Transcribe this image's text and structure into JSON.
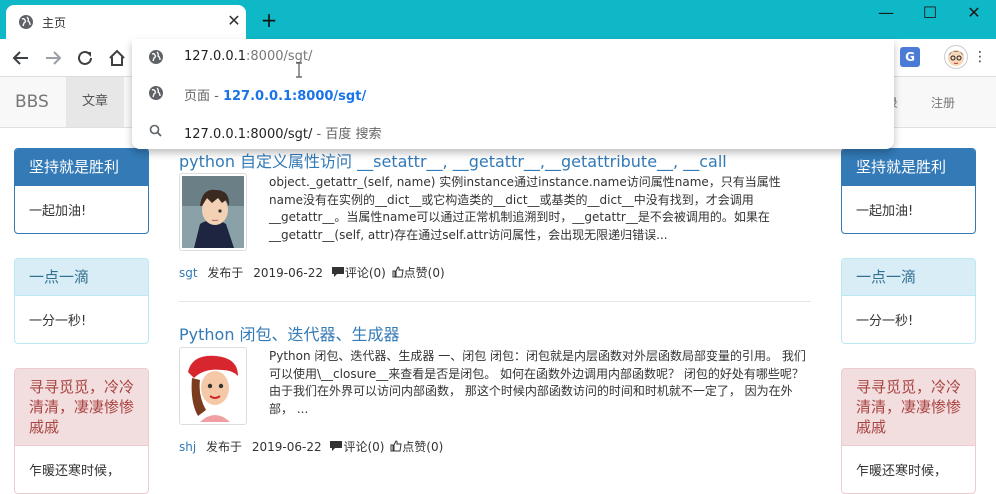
{
  "browser": {
    "tab_title": "主页",
    "tab_close": "✕",
    "new_tab": "+",
    "window": {
      "minimize": "—",
      "maximize": "☐",
      "close": "✕"
    },
    "address": {
      "host": "127.0.0.1",
      "port_path": ":8000/sgt/"
    },
    "suggestions": [
      {
        "icon": "globe-icon",
        "host": "127.0.0.1",
        "rest": ":8000/sgt/"
      },
      {
        "icon": "globe-icon",
        "prefix": "页面 - ",
        "link": "127.0.0.1:8000/sgt/"
      },
      {
        "icon": "search-icon",
        "text": "127.0.0.1:8000/sgt/",
        "suffix": " - 百度 搜索"
      }
    ],
    "translate_label": "G",
    "menu_glyph": "⋮"
  },
  "site": {
    "brand": "BBS",
    "nav_article": "文章",
    "nav_login": "录",
    "nav_register": "注册"
  },
  "panels_left": [
    {
      "heading": "坚持就是胜利",
      "body": "一起加油!"
    },
    {
      "heading": "一点一滴",
      "body": "一分一秒!"
    },
    {
      "heading": "寻寻觅觅，冷冷清清，凄凄惨惨戚戚",
      "body": "乍暖还寒时候，"
    }
  ],
  "panels_right": [
    {
      "heading": "坚持就是胜利",
      "body": "一起加油!"
    },
    {
      "heading": "一点一滴",
      "body": "一分一秒!"
    },
    {
      "heading": "寻寻觅觅，冷冷清清，凄凄惨惨戚戚",
      "body": "乍暖还寒时候，"
    }
  ],
  "articles": [
    {
      "title": "python 自定义属性访问 __setattr__, __getattr__,__getattribute__, __call",
      "summary": "object._getattr_(self, name) 实例instance通过instance.name访问属性name，只有当属性name没有在实例的__dict__或它构造类的__dict__或基类的__dict__中没有找到，才会调用__getattr__。当属性name可以通过正常机制追溯到时，__getattr__是不会被调用的。如果在__getattr__(self, attr)存在通过self.attr访问属性，会出现无限递归错误...",
      "author": "sgt",
      "published_label": "发布于",
      "date": "2019-06-22",
      "comments": "评论(0)",
      "likes": "点赞(0)"
    },
    {
      "title": "Python 闭包、迭代器、生成器",
      "summary": "Python 闭包、迭代器、生成器 一、闭包 闭包：闭包就是内层函数对外层函数局部变量的引用。 我们可以使用\\__closure__来查看是否是闭包。 如何在函数外边调用内部函数呢？ 闭包的好处有哪些呢？ 由于我们在外界可以访问内部函数， 那这个时候内部函数访问的时间和时机就不一定了， 因为在外部， ...",
      "author": "shj",
      "published_label": "发布于",
      "date": "2019-06-22",
      "comments": "评论(0)",
      "likes": "点赞(0)"
    }
  ]
}
